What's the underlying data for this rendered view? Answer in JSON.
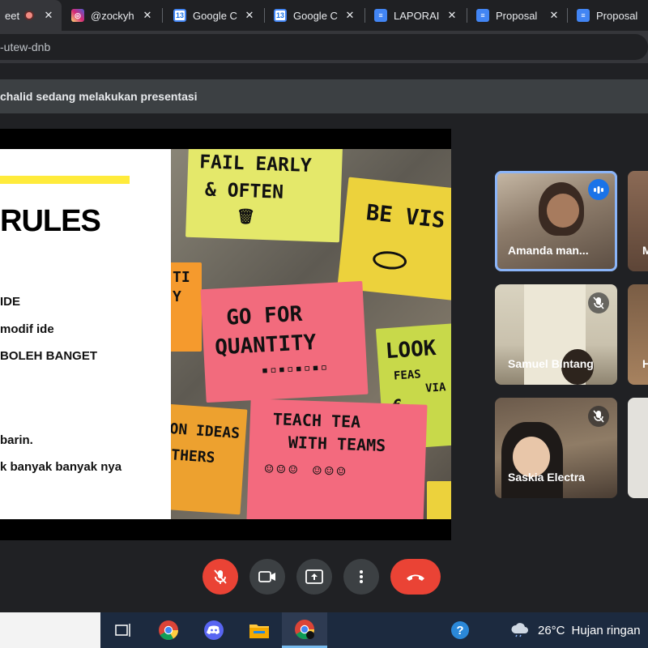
{
  "browser": {
    "tabs": [
      {
        "title": "eet",
        "favicon": "meet-recording-icon",
        "active": true
      },
      {
        "title": "@zockyh",
        "favicon": "instagram-icon",
        "active": false
      },
      {
        "title": "Google C",
        "favicon": "calendar-icon",
        "favicon_text": "13",
        "active": false
      },
      {
        "title": "Google C",
        "favicon": "calendar-icon",
        "favicon_text": "13",
        "active": false
      },
      {
        "title": "LAPORAI",
        "favicon": "docs-icon",
        "active": false
      },
      {
        "title": "Proposal",
        "favicon": "docs-icon",
        "active": false
      },
      {
        "title": "Proposal",
        "favicon": "docs-icon",
        "active": false
      }
    ],
    "close_glyph": "✕",
    "address": "-utew-dnb"
  },
  "meet": {
    "presenting_text": "chalid sedang melakukan presentasi",
    "slide": {
      "heading": "RULES",
      "lines": [
        "IDE",
        "modif ide",
        "BOLEH BANGET",
        "barin.",
        "k banyak banyak nya"
      ]
    },
    "sticky_notes": [
      "FAIL EARLY",
      "& OFTEN",
      "BE VIS",
      "GO FOR",
      "QUANTITY",
      "LOOK",
      "FEAS",
      "VIA",
      "TEACH TEA",
      "WITH TEAMS",
      "ON IDEAS",
      "THERS",
      "TI",
      "Y"
    ],
    "participants": [
      {
        "name": "Amanda man...",
        "state": "speaking"
      },
      {
        "name": "M",
        "state": "partial"
      },
      {
        "name": "Samuel Bintang",
        "state": "muted"
      },
      {
        "name": "H",
        "state": "partial"
      },
      {
        "name": "Saskia Electra",
        "state": "muted"
      },
      {
        "name": "",
        "state": "partial"
      }
    ],
    "controls": [
      "mic-off-icon",
      "camera-icon",
      "present-icon",
      "more-vert-icon",
      "end-call-icon"
    ]
  },
  "taskbar": {
    "apps": [
      "task-view-icon",
      "chrome-icon",
      "discord-icon",
      "file-explorer-icon",
      "chrome-active-icon"
    ],
    "help_icon": "help-icon",
    "weather_temp": "26°C",
    "weather_desc": "Hujan ringan"
  },
  "colors": {
    "accent": "#8ab4f8",
    "end_call": "#ea4335",
    "slide_highlight": "#ffeb3b"
  }
}
